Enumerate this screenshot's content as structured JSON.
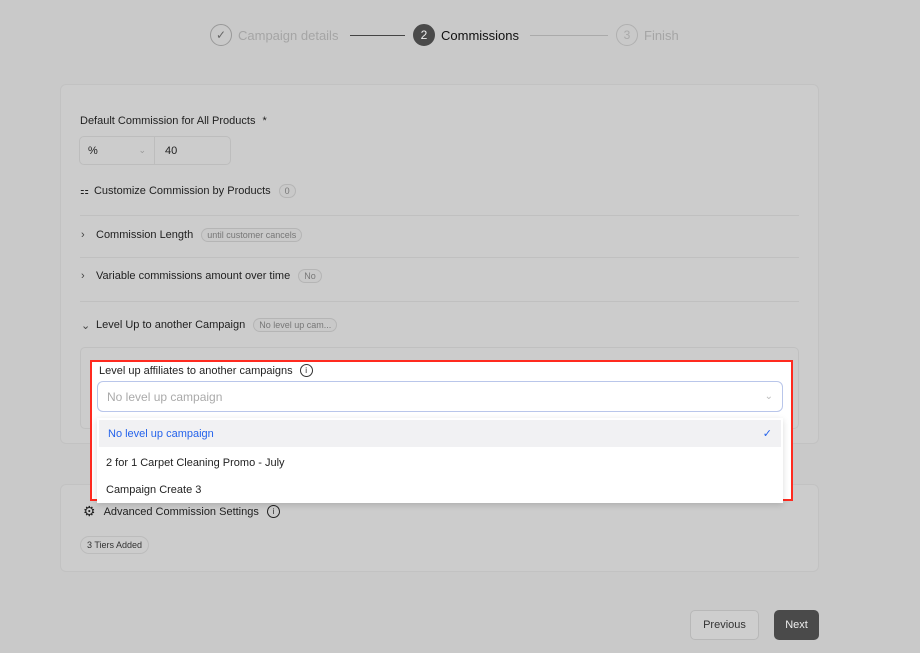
{
  "stepper": [
    {
      "label": "Campaign details",
      "state": "done"
    },
    {
      "number": "2",
      "label": "Commissions",
      "state": "active"
    },
    {
      "number": "3",
      "label": "Finish",
      "state": "pending"
    }
  ],
  "default_commission": {
    "label": "Default Commission for All Products",
    "required": "*",
    "type": "%",
    "value": "40"
  },
  "customize": {
    "label": "Customize Commission by Products",
    "count": "0"
  },
  "commission_length": {
    "label": "Commission Length",
    "badge": "until customer cancels"
  },
  "variable": {
    "label": "Variable commissions amount over time",
    "badge": "No"
  },
  "level_up": {
    "label": "Level Up to another Campaign",
    "badge": "No level up cam...",
    "field_label": "Level up affiliates to another campaigns",
    "placeholder": "No level up campaign",
    "options": [
      "No level up campaign",
      "2 for 1 Carpet Cleaning Promo - July",
      "Campaign Create 3"
    ],
    "selected": "No level up campaign"
  },
  "advanced": {
    "label": "Advanced Commission Settings",
    "badge": "3 Tiers Added"
  },
  "buttons": {
    "previous": "Previous",
    "next": "Next"
  },
  "colors": {
    "accent": "#2563eb",
    "highlight": "#ff2a1f"
  }
}
